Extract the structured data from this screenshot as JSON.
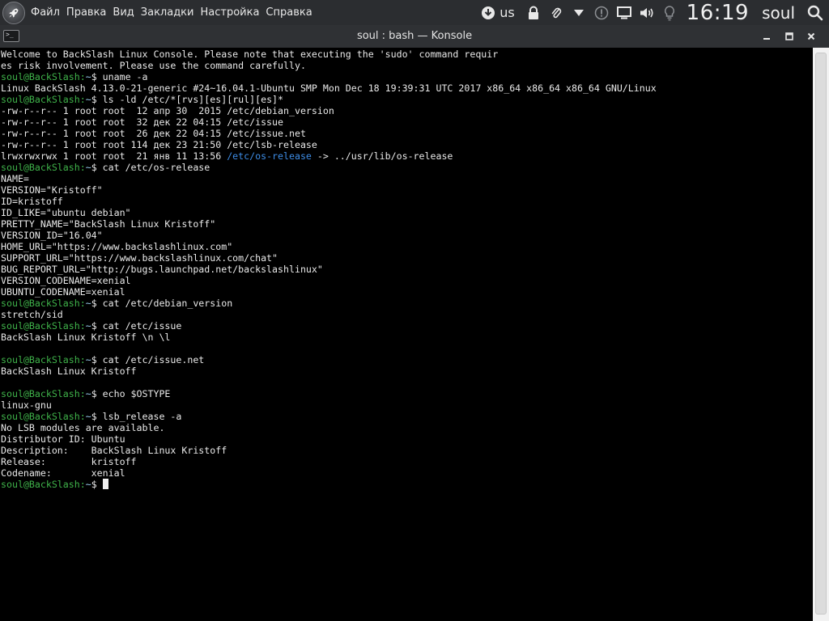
{
  "panel": {
    "menu": [
      "Файл",
      "Правка",
      "Вид",
      "Закладки",
      "Настройка",
      "Справка"
    ],
    "keyboard_layout": "us",
    "clock": "16:19",
    "user": "soul"
  },
  "window": {
    "title": "soul : bash — Konsole",
    "app_icon_text": ">_"
  },
  "terminal": {
    "prompt_user": "soul@BackSlash",
    "prompt_sep": ":",
    "prompt_dir": "~",
    "prompt_sign": "$",
    "lines": [
      {
        "type": "out",
        "text": "Welcome to BackSlash Linux Console. Please note that executing the 'sudo' command requir"
      },
      {
        "type": "out",
        "text": "es risk involvement. Please use the command carefully."
      },
      {
        "type": "cmd",
        "text": " uname -a"
      },
      {
        "type": "out",
        "text": "Linux BackSlash 4.13.0-21-generic #24~16.04.1-Ubuntu SMP Mon Dec 18 19:39:31 UTC 2017 x86_64 x86_64 x86_64 GNU/Linux"
      },
      {
        "type": "cmd",
        "text": " ls -ld /etc/*[rvs][es][rul][es]*"
      },
      {
        "type": "out",
        "text": "-rw-r--r-- 1 root root  12 апр 30  2015 /etc/debian_version"
      },
      {
        "type": "out",
        "text": "-rw-r--r-- 1 root root  32 дек 22 04:15 /etc/issue"
      },
      {
        "type": "out",
        "text": "-rw-r--r-- 1 root root  26 дек 22 04:15 /etc/issue.net"
      },
      {
        "type": "out",
        "text": "-rw-r--r-- 1 root root 114 дек 23 21:50 /etc/lsb-release"
      },
      {
        "type": "link",
        "text": "lrwxrwxrwx 1 root root  21 янв 11 13:56 ",
        "link": "/etc/os-release",
        "rest": " -> ../usr/lib/os-release"
      },
      {
        "type": "cmd",
        "text": " cat /etc/os-release"
      },
      {
        "type": "out",
        "text": "NAME="
      },
      {
        "type": "out",
        "text": "VERSION=\"Kristoff\""
      },
      {
        "type": "out",
        "text": "ID=kristoff"
      },
      {
        "type": "out",
        "text": "ID_LIKE=\"ubuntu debian\""
      },
      {
        "type": "out",
        "text": "PRETTY_NAME=\"BackSlash Linux Kristoff\""
      },
      {
        "type": "out",
        "text": "VERSION_ID=\"16.04\""
      },
      {
        "type": "out",
        "text": "HOME_URL=\"https://www.backslashlinux.com\""
      },
      {
        "type": "out",
        "text": "SUPPORT_URL=\"https://www.backslashlinux.com/chat\""
      },
      {
        "type": "out",
        "text": "BUG_REPORT_URL=\"http://bugs.launchpad.net/backslashlinux\""
      },
      {
        "type": "out",
        "text": "VERSION_CODENAME=xenial"
      },
      {
        "type": "out",
        "text": "UBUNTU_CODENAME=xenial"
      },
      {
        "type": "cmd",
        "text": " cat /etc/debian_version"
      },
      {
        "type": "out",
        "text": "stretch/sid"
      },
      {
        "type": "cmd",
        "text": " cat /etc/issue"
      },
      {
        "type": "out",
        "text": "BackSlash Linux Kristoff \\n \\l"
      },
      {
        "type": "out",
        "text": ""
      },
      {
        "type": "cmd",
        "text": " cat /etc/issue.net"
      },
      {
        "type": "out",
        "text": "BackSlash Linux Kristoff"
      },
      {
        "type": "out",
        "text": ""
      },
      {
        "type": "cmd",
        "text": " echo $OSTYPE"
      },
      {
        "type": "out",
        "text": "linux-gnu"
      },
      {
        "type": "cmd",
        "text": " lsb_release -a"
      },
      {
        "type": "out",
        "text": "No LSB modules are available."
      },
      {
        "type": "out",
        "text": "Distributor ID:\tUbuntu"
      },
      {
        "type": "out",
        "text": "Description:\tBackSlash Linux Kristoff"
      },
      {
        "type": "out",
        "text": "Release:\tkristoff"
      },
      {
        "type": "out",
        "text": "Codename:\txenial"
      },
      {
        "type": "prompt",
        "text": " "
      }
    ]
  },
  "colors": {
    "prompt": "#3fb34a",
    "link": "#3e8ee8",
    "text": "#e9e9e9",
    "background": "#000000"
  },
  "icons": {
    "launcher": "rocket-icon",
    "download": "download-icon",
    "lock": "lock-icon",
    "clip": "paperclip-icon",
    "dropdown": "chevron-down-icon",
    "notify": "notification-icon",
    "display": "display-icon",
    "volume": "volume-icon",
    "bulb": "lightbulb-icon",
    "search": "search-icon"
  }
}
